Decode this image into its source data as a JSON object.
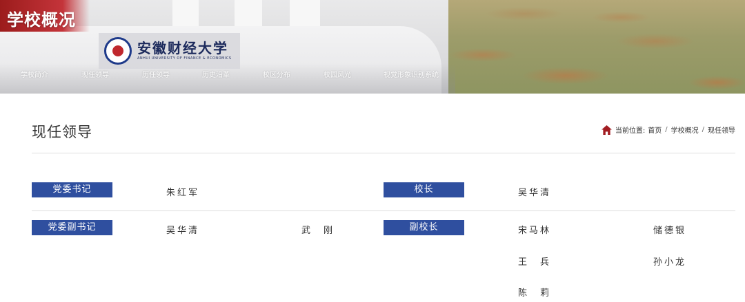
{
  "banner": {
    "section_title": "学校概况",
    "logo_cn": "安徽财经大学",
    "logo_en": "ANHUI UNIVERSITY OF FINANCE & ECONOMICS"
  },
  "nav": {
    "items": [
      {
        "label": "学校简介"
      },
      {
        "label": "现任领导"
      },
      {
        "label": "历任领导"
      },
      {
        "label": "历史沿革"
      },
      {
        "label": "校区分布"
      },
      {
        "label": "校园风光"
      },
      {
        "label": "视觉形象识别系统"
      }
    ]
  },
  "page": {
    "heading": "现任领导",
    "breadcrumb": {
      "prefix": "当前位置:",
      "items": [
        "首页",
        "学校概况",
        "现任领导"
      ],
      "separator": "/"
    }
  },
  "leaders": {
    "party_secretary": {
      "label": "党委书记",
      "names": [
        "朱红军"
      ]
    },
    "president": {
      "label": "校长",
      "names": [
        "吴华清"
      ]
    },
    "deputy_party_secretary": {
      "label": "党委副书记",
      "names": [
        "吴华清",
        "武　刚"
      ]
    },
    "vice_president": {
      "label": "副校长",
      "names": [
        "宋马林",
        "储德银",
        "王　兵",
        "孙小龙",
        "陈　莉"
      ]
    }
  },
  "colors": {
    "label_bg": "#2f4f9f",
    "home_icon": "#a21d22",
    "banner_red": "#c4343a"
  }
}
